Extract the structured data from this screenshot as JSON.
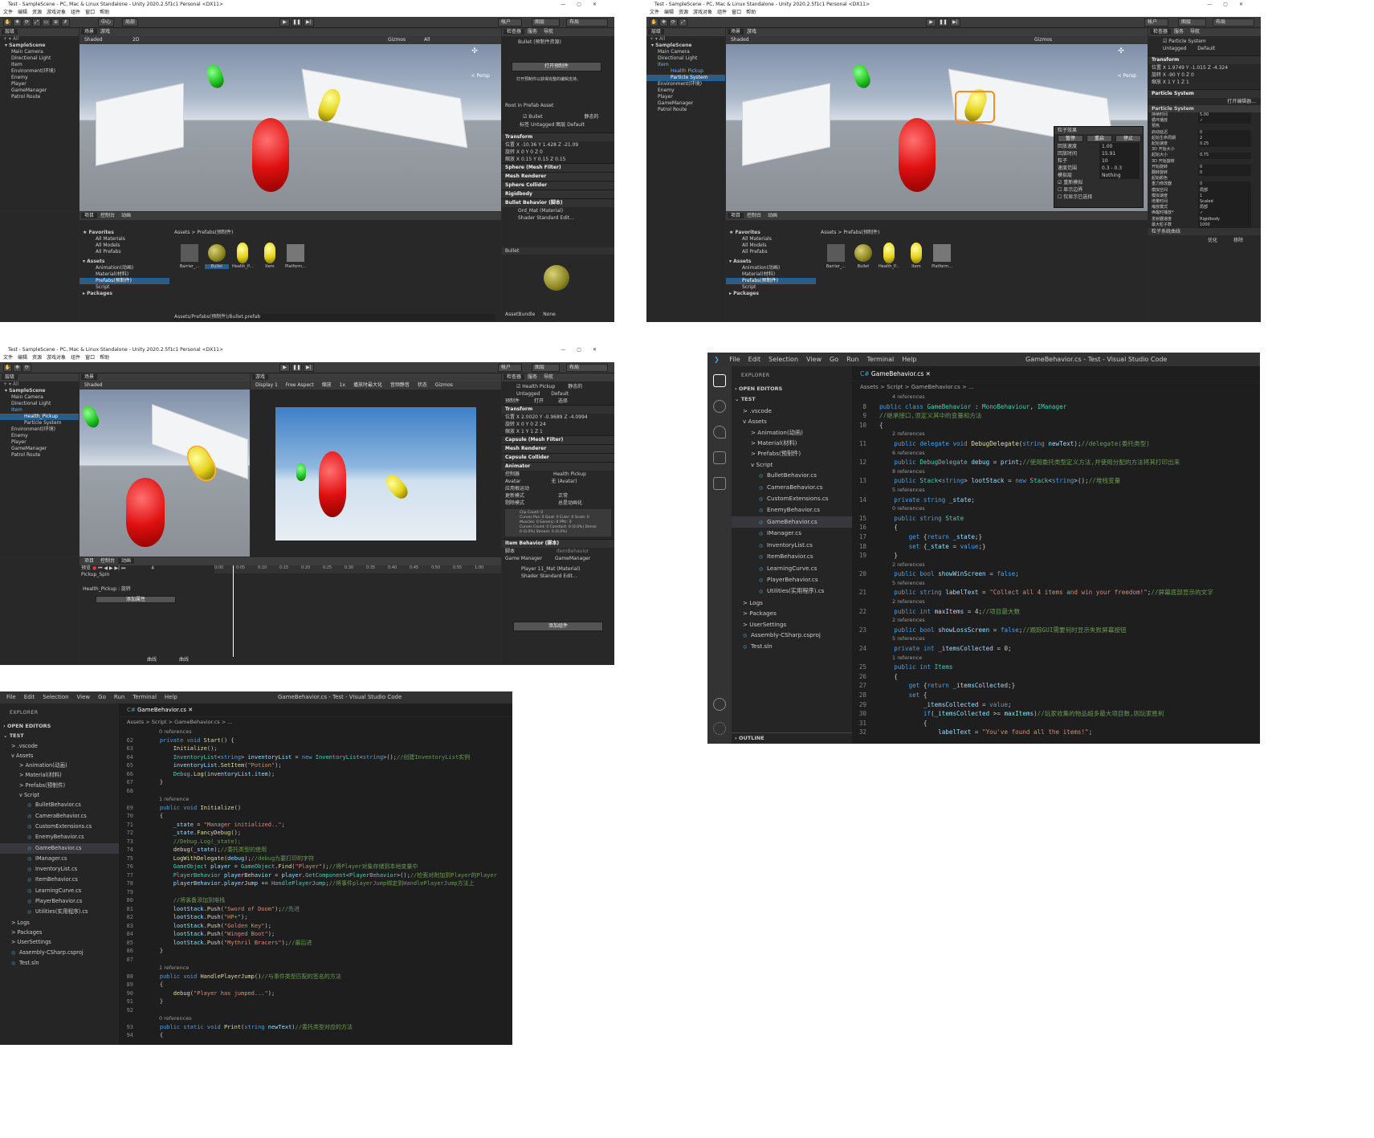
{
  "unity": {
    "window_title": "Test - SampleScene - PC, Mac & Linux Standalone - Unity 2020.2.5f1c1 Personal <DX11>",
    "menus": [
      "文件",
      "编辑",
      "资源",
      "游戏对象",
      "组件",
      "窗口",
      "帮助"
    ],
    "toolbar": {
      "center_label": "中心",
      "local_label": "局部",
      "account": "帐户",
      "layers": "图层",
      "layout": "布局"
    },
    "tabs": {
      "hierarchy": "层级",
      "scene": "场景",
      "game": "游戏",
      "inspector": "检查器",
      "services": "服务",
      "navigation": "导航",
      "project": "项目",
      "console": "控制台",
      "animation": "动画"
    },
    "scene_toolbar": {
      "shading": "Shaded",
      "mode_2d": "2D",
      "gizmos": "Gizmos",
      "search": "All",
      "persp": "< Persp"
    },
    "hierarchy": {
      "search": "All",
      "scene": "SampleScene",
      "items": [
        "Main Camera",
        "Directional Light",
        "Item",
        "Environment(环境)",
        "Enemy",
        "Player",
        "GameManager",
        "Patrol Route"
      ],
      "items_win2": [
        "Main Camera",
        "Directional Light",
        "Item",
        "Health Pickup",
        "Particle System",
        "Environment(环境)",
        "Enemy",
        "Player",
        "GameManager",
        "Patrol Route"
      ],
      "items_win3": [
        "Main Camera",
        "Directional Light",
        "Item",
        "Health_Pickup",
        "Particle System",
        "Environment(环境)",
        "Enemy",
        "Player",
        "GameManager",
        "Patrol Route"
      ]
    },
    "project": {
      "favorites": "Favorites",
      "fav_items": [
        "All Materials",
        "All Models",
        "All Prefabs"
      ],
      "assets": "Assets",
      "asset_folders": [
        "Animation(动画)",
        "Material(材料)",
        "Prefabs(预制件)",
        "Script"
      ],
      "packages": "Packages",
      "breadcrumb": "Assets > Prefabs(预制件)",
      "thumbs": [
        "Barrier_...",
        "Bullet",
        "Health_P...",
        "Item",
        "Platform..."
      ],
      "path": "Assets/Prefabs(预制件)/Bullet.prefab"
    },
    "inspector1": {
      "title": "Bullet (预制件资源)",
      "open_prefab": "打开预制件",
      "info": "打开预制件以获得完整的编辑支持。",
      "root": "Root in Prefab Asset",
      "name": "Bullet",
      "static": "静态的",
      "tag_label": "标签",
      "tag": "Untagged",
      "layer_label": "图层",
      "layer": "Default",
      "transform": "Transform",
      "pos_label": "位置",
      "rot_label": "旋转",
      "scale_label": "缩放",
      "pos": [
        "-10.36",
        "1.428",
        "-21.09"
      ],
      "rot": [
        "0",
        "0",
        "0"
      ],
      "scale": [
        "0.15",
        "0.15",
        "0.15"
      ],
      "components": [
        "Sphere (Mesh Filter)",
        "Mesh Renderer",
        "Sphere Collider",
        "Rigidbody",
        "Bullet Behavior (脚本)"
      ],
      "material": "Ord_Mat (Material)",
      "shader_label": "Shader",
      "shader": "Standard",
      "edit": "Edit...",
      "preview": "Bullet",
      "assetbundle": "AssetBundle",
      "none": "None"
    },
    "inspector2": {
      "name": "Particle System",
      "tag": "Untagged",
      "layer": "Default",
      "transform": "Transform",
      "pos": [
        "1.9749",
        "-1.015",
        "-4.324"
      ],
      "rot": [
        "-90",
        "0",
        "0"
      ],
      "scale": [
        "1",
        "1",
        "1"
      ],
      "component": "Particle System",
      "open_editor": "打开编辑器...",
      "module": "Particle System",
      "curves": "粒子系统曲线",
      "optimize": "优化",
      "remove": "移除",
      "rows": [
        [
          "持续时间",
          "5.00"
        ],
        [
          "循环播放",
          "✓"
        ],
        [
          "预热",
          ""
        ],
        [
          "启动延迟",
          "0"
        ],
        [
          "起始生命周期",
          "2"
        ],
        [
          "起始速度",
          "0.25"
        ],
        [
          "3D 开始大小",
          ""
        ],
        [
          "起始大小",
          "0.75"
        ],
        [
          "3D 开始旋转",
          ""
        ],
        [
          "开始旋转",
          "0"
        ],
        [
          "翻转旋转",
          "0"
        ],
        [
          "起始颜色",
          ""
        ],
        [
          "重力修改器",
          "0"
        ],
        [
          "模拟空间",
          "局部"
        ],
        [
          "模拟速度",
          "1"
        ],
        [
          "增量时间",
          "Scaled"
        ],
        [
          "缩放模式",
          "局部"
        ],
        [
          "唤醒时播放*",
          "✓"
        ],
        [
          "发射器速度",
          "Rigidbody"
        ],
        [
          "最大粒子数",
          "1000"
        ]
      ]
    },
    "particle_overlay": {
      "title": "粒子效果",
      "pause": "暂停",
      "restart": "重启",
      "stop": "停止",
      "rows": [
        [
          "回放速度",
          "1.00"
        ],
        [
          "回放时间",
          "15.91"
        ],
        [
          "粒子",
          "10"
        ],
        [
          "速度范围",
          "0.3 - 0.3"
        ],
        [
          "模拟层",
          "Nothing"
        ]
      ],
      "checks": [
        "重新模拟",
        "显示边界",
        "仅显示已选择"
      ]
    },
    "inspector3": {
      "name": "Health Pickup",
      "static": "静态的",
      "tag": "Untagged",
      "layer": "Default",
      "prefab_label": "预制件",
      "open": "打开",
      "select": "选择",
      "transform": "Transform",
      "pos": [
        "2.0020",
        "-0.9689",
        "-4.0994"
      ],
      "rot": [
        "0",
        "0",
        "24"
      ],
      "scale": [
        "1",
        "1",
        "1"
      ],
      "components": [
        "Capsule (Mesh Filter)",
        "Mesh Renderer",
        "Capsule Collider",
        "Animator"
      ],
      "controller_label": "控制器",
      "controller": "Health Pickup",
      "avatar_label": "Avatar",
      "avatar": "无 (Avatar)",
      "root_motion": "应用根运动",
      "update_label": "更新模式",
      "update": "正常",
      "culling_label": "剔除模式",
      "culling": "总是动画化",
      "clip_info": "Clip Count: 0\nCurves Pos: 0 Quat: 0 Euler: 0 Scale: 0\nMuscles: 0 Generic: 0 PPtr: 0\nCurves Count: 0 Constant: 0 (0.0%) Dense\n0 (0.0%) Stream: 0 (0.0%)",
      "item_behavior": "Item Behavior (脚本)",
      "script_label": "脚本",
      "script": "ItemBehavior",
      "gm_label": "Game Manager",
      "gm": "GameManager",
      "material": "Player 11_Mat (Material)",
      "shader": "Standard",
      "edit": "Edit...",
      "add_component": "添加组件"
    },
    "game_view": {
      "display": "Display 1",
      "aspect": "Free Aspect",
      "scale_label": "缩放",
      "scale": "1x",
      "maximize": "播放时最大化",
      "mute": "音频静音",
      "stats": "状态",
      "gizmos": "Gizmos"
    },
    "animation": {
      "preview": "预览",
      "frame": "4",
      "clip": "Pickup_Spin",
      "ticks": [
        "0:00",
        "0:05",
        "0:10",
        "0:15",
        "0:20",
        "0:25",
        "0:30",
        "0:35",
        "0:40",
        "0:45",
        "0:50",
        "0:55",
        "1:00"
      ],
      "property": "Health_Pickup : 旋转",
      "add_property": "添加属性",
      "bottom_tabs": [
        "曲线",
        "曲线"
      ]
    }
  },
  "vscode1": {
    "menus": [
      "File",
      "Edit",
      "Selection",
      "View",
      "Go",
      "Run",
      "Terminal",
      "Help"
    ],
    "title": "GameBehavior.cs - Test - Visual Studio Code",
    "explorer": "EXPLORER",
    "open_editors": "OPEN EDITORS",
    "project": "TEST",
    "tree": [
      {
        "t": "> .vscode",
        "d": 1
      },
      {
        "t": "v Assets",
        "d": 1
      },
      {
        "t": "> Animation(动画)",
        "d": 2
      },
      {
        "t": "> Material(材料)",
        "d": 2
      },
      {
        "t": "> Prefabs(预制件)",
        "d": 2
      },
      {
        "t": "v Script",
        "d": 2
      },
      {
        "t": "BulletBehavior.cs",
        "d": 3,
        "f": true
      },
      {
        "t": "CameraBehavior.cs",
        "d": 3,
        "f": true
      },
      {
        "t": "CustomExtensions.cs",
        "d": 3,
        "f": true
      },
      {
        "t": "EnemyBehavior.cs",
        "d": 3,
        "f": true
      },
      {
        "t": "GameBehavior.cs",
        "d": 3,
        "f": true,
        "sel": true
      },
      {
        "t": "IManager.cs",
        "d": 3,
        "f": true
      },
      {
        "t": "InventoryList.cs",
        "d": 3,
        "f": true
      },
      {
        "t": "ItemBehavior.cs",
        "d": 3,
        "f": true
      },
      {
        "t": "LearningCurve.cs",
        "d": 3,
        "f": true
      },
      {
        "t": "PlayerBehavior.cs",
        "d": 3,
        "f": true
      },
      {
        "t": "Utilities(实用程序).cs",
        "d": 3,
        "f": true
      },
      {
        "t": "> Logs",
        "d": 1
      },
      {
        "t": "> Packages",
        "d": 1
      },
      {
        "t": "> UserSettings",
        "d": 1
      },
      {
        "t": "Assembly-CSharp.csproj",
        "d": 1,
        "f": true
      },
      {
        "t": "Test.sln",
        "d": 1,
        "f": true
      }
    ],
    "outline": "OUTLINE",
    "tab": "GameBehavior.cs",
    "breadcrumb": "Assets > Script > GameBehavior.cs > ...",
    "lines": [
      {
        "lens": "4 references"
      },
      {
        "n": "8",
        "c": "public class GameBehavior : MonoBehaviour, IManager"
      },
      {
        "n": "9",
        "c": "//继承接口,须定义其中的变量和方法"
      },
      {
        "n": "10",
        "c": "{"
      },
      {
        "lens": "2 references"
      },
      {
        "n": "11",
        "c": "    public delegate void DebugDelegate(string newText);//delegate(委托类型)"
      },
      {
        "lens": "6 references"
      },
      {
        "n": "12",
        "c": "    public DebugDelegate debug = print;//使用委托类型定义方法,并使用分配的方法将其打印出来"
      },
      {
        "lens": "8 references"
      },
      {
        "n": "13",
        "c": "    public Stack<string> lootStack = new Stack<string>();//堆栈变量"
      },
      {
        "lens": "5 references"
      },
      {
        "n": "14",
        "c": "    private string _state;"
      },
      {
        "lens": "0 references"
      },
      {
        "n": "15",
        "c": "    public string State"
      },
      {
        "n": "16",
        "c": "    {"
      },
      {
        "n": "17",
        "c": "        get {return _state;}"
      },
      {
        "n": "18",
        "c": "        set {_state = value;}"
      },
      {
        "n": "19",
        "c": "    }"
      },
      {
        "lens": "2 references"
      },
      {
        "n": "20",
        "c": "    public bool showWinScreen = false;"
      },
      {
        "lens": "5 references"
      },
      {
        "n": "21",
        "c": "    public string labelText = \"Collect all 4 items and win your freedom!\";//屏幕底部显示的文字"
      },
      {
        "lens": "2 references"
      },
      {
        "n": "22",
        "c": "    public int maxItems = 4;//项目最大数"
      },
      {
        "lens": "2 references"
      },
      {
        "n": "23",
        "c": "    public bool showLossScreen = false;//跟踪GUI需要何时显示失败屏幕按钮"
      },
      {
        "lens": "5 references"
      },
      {
        "n": "24",
        "c": "    private int _itemsCollected = 0;"
      },
      {
        "lens": "1 reference"
      },
      {
        "n": "25",
        "c": "    public int Items"
      },
      {
        "n": "26",
        "c": "    {"
      },
      {
        "n": "27",
        "c": "        get {return _itemsCollected;}"
      },
      {
        "n": "28",
        "c": "        set {"
      },
      {
        "n": "29",
        "c": "            _itemsCollected = value;"
      },
      {
        "n": "30",
        "c": "            if(_itemsCollected >= maxItems)//玩家收集的物品超多最大项目数,则玩家胜利"
      },
      {
        "n": "31",
        "c": "            {"
      },
      {
        "n": "32",
        "c": "                labelText = \"You've found all the items!\";"
      }
    ]
  },
  "vscode2": {
    "title": "GameBehavior.cs - Test - Visual Studio Code",
    "tab": "GameBehavior.cs",
    "breadcrumb": "Assets > Script > GameBehavior.cs > ...",
    "lines": [
      {
        "lens": "0 references"
      },
      {
        "n": "62",
        "c": "    private void Start() {"
      },
      {
        "n": "63",
        "c": "        Initialize();"
      },
      {
        "n": "64",
        "c": "        InventoryList<string> inventoryList = new InventoryList<string>();//创建InventoryList实例"
      },
      {
        "n": "65",
        "c": "        inventoryList.SetItem(\"Potion\");"
      },
      {
        "n": "66",
        "c": "        Debug.Log(inventoryList.item);"
      },
      {
        "n": "67",
        "c": "    }"
      },
      {
        "n": "68",
        "c": ""
      },
      {
        "lens": "1 reference"
      },
      {
        "n": "69",
        "c": "    public void Initialize()"
      },
      {
        "n": "70",
        "c": "    {"
      },
      {
        "n": "71",
        "c": "        _state = \"Manager initialized..\";"
      },
      {
        "n": "72",
        "c": "        _state.FancyDebug();"
      },
      {
        "n": "73",
        "c": "        //Debug.Log(_state);"
      },
      {
        "n": "74",
        "c": "        debug(_state);//委托类型的使用"
      },
      {
        "n": "75",
        "c": "        LogWithDelegate(debug);//debug为要打印的字符"
      },
      {
        "n": "76",
        "c": "        GameObject player = GameObject.Find(\"Player\");//将Player对象存储到本地变量中"
      },
      {
        "n": "77",
        "c": "        PlayerBehavior playerBehavior = player.GetComponent<PlayerBehavior>();//检索对附加到Player的Player"
      },
      {
        "n": "78",
        "c": "        playerBehavior.playerJump += HandlePlayerJump;//将事件playerJump绑定到HandlePlayerJump方法上"
      },
      {
        "n": "79",
        "c": ""
      },
      {
        "n": "80",
        "c": "        //将装备添加到堆栈"
      },
      {
        "n": "81",
        "c": "        lootStack.Push(\"Sword of Doom\");//先进"
      },
      {
        "n": "82",
        "c": "        lootStack.Push(\"HP+\");"
      },
      {
        "n": "83",
        "c": "        lootStack.Push(\"Golden Key\");"
      },
      {
        "n": "84",
        "c": "        lootStack.Push(\"Winged Boot\");"
      },
      {
        "n": "85",
        "c": "        lootStack.Push(\"Mythril Bracers\");//最后进"
      },
      {
        "n": "86",
        "c": "    }"
      },
      {
        "n": "87",
        "c": ""
      },
      {
        "lens": "1 reference"
      },
      {
        "n": "88",
        "c": "    public void HandlePlayerJump()//与事件类型匹配的签名的方法"
      },
      {
        "n": "89",
        "c": "    {"
      },
      {
        "n": "90",
        "c": "        debug(\"Player has jumped...\");"
      },
      {
        "n": "91",
        "c": "    }"
      },
      {
        "n": "92",
        "c": ""
      },
      {
        "lens": "0 references"
      },
      {
        "n": "93",
        "c": "    public static void Print(string newText)//委托类型对应的方法"
      },
      {
        "n": "94",
        "c": "    {"
      }
    ]
  }
}
